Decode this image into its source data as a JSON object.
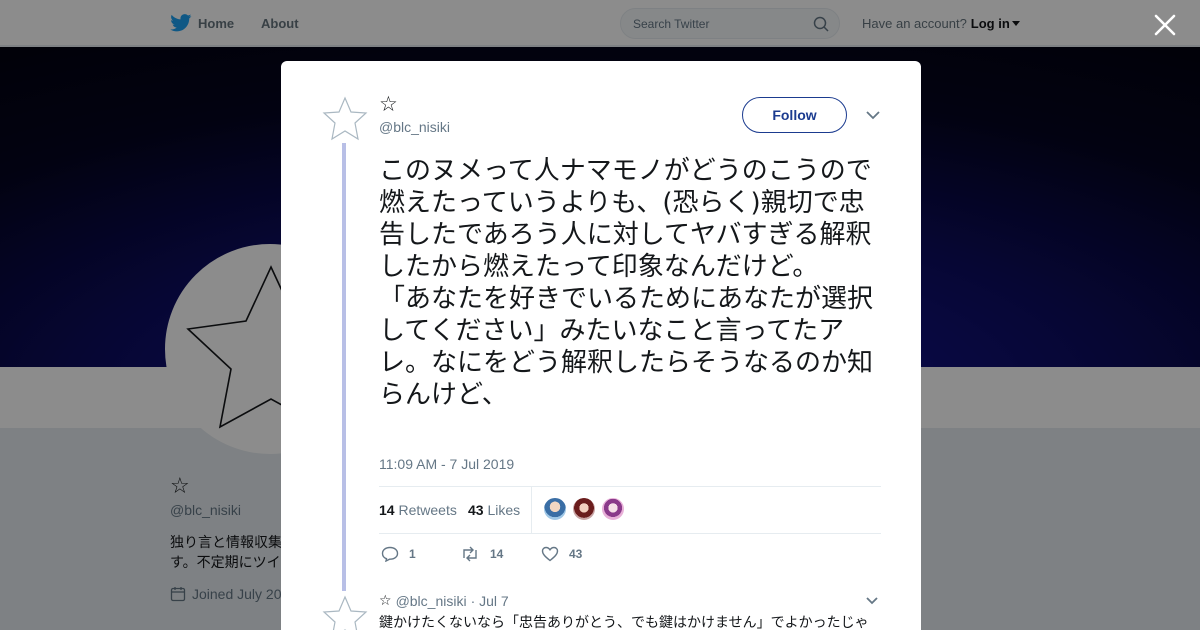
{
  "topbar": {
    "home_label": "Home",
    "about_label": "About",
    "search_placeholder": "Search Twitter",
    "account_prompt": "Have an account?",
    "login_label": "Log in"
  },
  "profile": {
    "name": "☆",
    "handle": "@blc_nisiki",
    "bio": "独り言と情報収集す。不定期にツイ",
    "joined": "Joined July 20"
  },
  "tweet": {
    "name": "☆",
    "handle": "@blc_nisiki",
    "follow_label": "Follow",
    "text": "このヌメって人ナマモノがどうのこうので燃えたっていうよりも、(恐らく)親切で忠告したであろう人に対してヤバすぎる解釈したから燃えたって印象なんだけど。\n「あなたを好きでいるためにあなたが選択してください」みたいなこと言ってたアレ。なにをどう解釈したらそうなるのか知らんけど、",
    "timestamp": "11:09 AM - 7 Jul 2019",
    "retweets_count": "14",
    "retweets_label": "Retweets",
    "likes_count": "43",
    "likes_label": "Likes",
    "actions": {
      "replies": "1",
      "retweets": "14",
      "likes": "43"
    }
  },
  "reply": {
    "name": "☆",
    "handle": "@blc_nisiki",
    "date": "· Jul 7",
    "text": "鍵かけたくないなら「忠告ありがとう、でも鍵はかけません」でよかったじゃ"
  },
  "colors": {
    "link_blue": "#1b3b8f",
    "twitter_blue": "#1da1f2",
    "thread_line": "#b8bfe6",
    "text_secondary": "#657786"
  }
}
